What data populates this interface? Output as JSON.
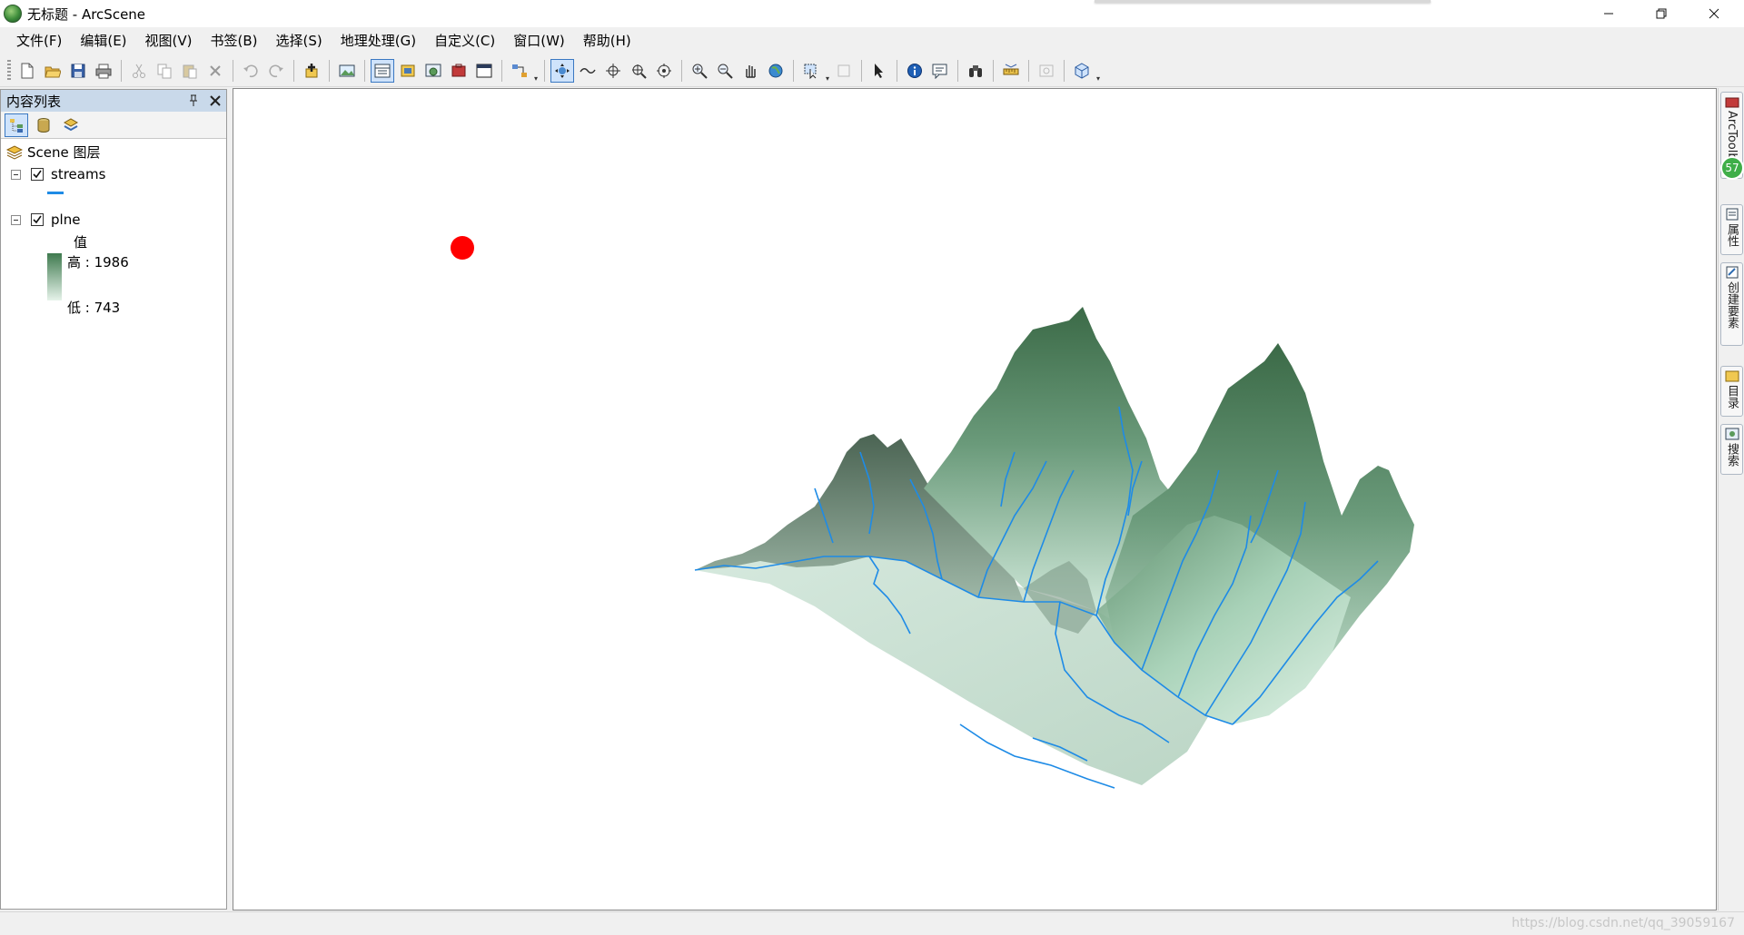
{
  "window": {
    "title": "无标题 - ArcScene",
    "app_icon": "arcscene-globe-icon",
    "controls": [
      "minimize-icon",
      "restore-icon",
      "close-icon"
    ]
  },
  "menu": [
    "文件(F)",
    "编辑(E)",
    "视图(V)",
    "书签(B)",
    "选择(S)",
    "地理处理(G)",
    "自定义(C)",
    "窗口(W)",
    "帮助(H)"
  ],
  "toc": {
    "title": "内容列表",
    "root_label": "Scene 图层",
    "layers": [
      {
        "name": "streams",
        "checked": true,
        "symbol_color": "#1e8be6"
      },
      {
        "name": "plne",
        "checked": true,
        "legend_field": "值",
        "high_label": "高 : 1986",
        "low_label": "低 : 743",
        "ramp_high": "#3f7a4f",
        "ramp_low": "#e6f3ea"
      }
    ]
  },
  "right_dock": [
    "ArcToolbox",
    "属性",
    "创建要素",
    "目录",
    "搜索"
  ],
  "right_dock_badge": "57",
  "colors": {
    "marker": "#ff0000",
    "stream": "#1e8be6",
    "terrain_dark": "#3f6f4b",
    "terrain_light": "#d4ebdd"
  },
  "watermark": "https://blog.csdn.net/qq_39059167"
}
